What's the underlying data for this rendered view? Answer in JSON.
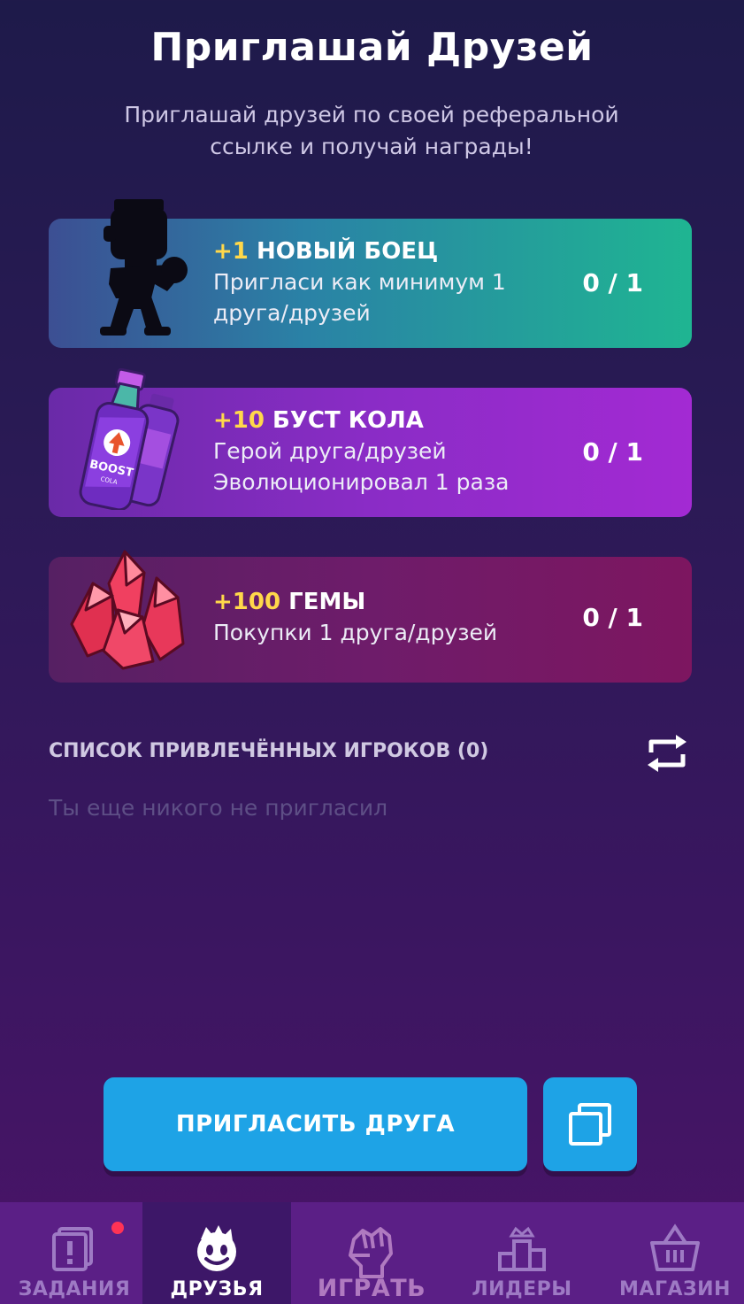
{
  "header": {
    "title": "Приглашай Друзей",
    "subtitle": "Приглашай друзей по своей реферальной ссылке и получай награды!"
  },
  "rewards": [
    {
      "plus": "+1",
      "name": "НОВЫЙ БОЕЦ",
      "desc": "Пригласи как минимум 1 друга/друзей",
      "progress": "0 / 1",
      "icon": "fighter-silhouette-icon"
    },
    {
      "plus": "+10",
      "name": "БУСТ КОЛА",
      "desc": "Герой друга/друзей Эволюционировал 1 раза",
      "progress": "0 / 1",
      "icon": "boost-cola-icon"
    },
    {
      "plus": "+100",
      "name": "ГЕМЫ",
      "desc": "Покупки 1 друга/друзей",
      "progress": "0 / 1",
      "icon": "gems-icon"
    }
  ],
  "invited": {
    "title": "СПИСОК ПРИВЛЕЧЁННЫХ ИГРОКОВ (0)",
    "empty": "Ты еще никого не пригласил"
  },
  "actions": {
    "invite_label": "ПРИГЛАСИТЬ ДРУГА"
  },
  "nav": {
    "tasks": "ЗАДАНИЯ",
    "friends": "ДРУЗЬЯ",
    "play": "ИГРАТЬ",
    "leaders": "ЛИДЕРЫ",
    "shop": "МАГАЗИН"
  },
  "colors": {
    "accent_blue": "#1ea3e6",
    "highlight_yellow": "#ffd84a",
    "notification_red": "#ff3355"
  }
}
